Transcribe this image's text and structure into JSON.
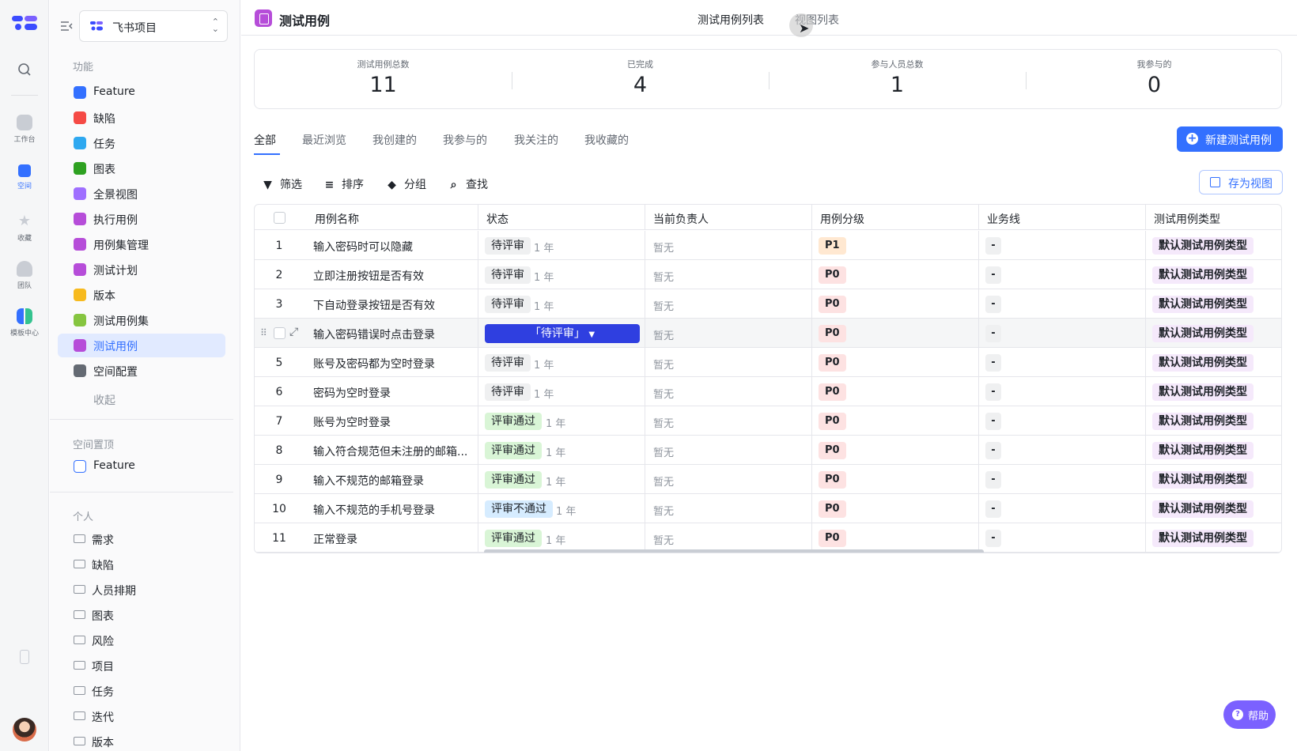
{
  "rail": {
    "items": [
      {
        "label": "",
        "icon": "search-icon"
      },
      {
        "label": "工作台",
        "icon": "home-icon"
      },
      {
        "label": "空间",
        "icon": "space-icon"
      },
      {
        "label": "收藏",
        "icon": "star-icon"
      },
      {
        "label": "团队",
        "icon": "team-icon"
      },
      {
        "label": "模板中心",
        "icon": "template-icon"
      }
    ]
  },
  "sidebar": {
    "project": "飞书项目",
    "features_title": "功能",
    "features": [
      {
        "label": "Feature",
        "color": "#3370ff"
      },
      {
        "label": "缺陷",
        "color": "#f54a45"
      },
      {
        "label": "任务",
        "color": "#2ea8f0"
      },
      {
        "label": "图表",
        "color": "#2ea121"
      },
      {
        "label": "全景视图",
        "color": "#9f6fff"
      },
      {
        "label": "执行用例",
        "color": "#b64dd9"
      },
      {
        "label": "用例集管理",
        "color": "#b64dd9"
      },
      {
        "label": "测试计划",
        "color": "#b64dd9"
      },
      {
        "label": "版本",
        "color": "#f7ba1e"
      },
      {
        "label": "测试用例集",
        "color": "#86c540"
      },
      {
        "label": "测试用例",
        "color": "#b64dd9"
      },
      {
        "label": "空间配置",
        "color": "#646a73"
      }
    ],
    "collapse_label": "收起",
    "pinned_title": "空间置顶",
    "pinned": [
      {
        "label": "Feature"
      }
    ],
    "personal_title": "个人",
    "personal": [
      "需求",
      "缺陷",
      "人员排期",
      "图表",
      "风险",
      "项目",
      "任务",
      "迭代",
      "版本"
    ]
  },
  "header": {
    "title": "测试用例",
    "tabs": [
      "测试用例列表",
      "视图列表"
    ]
  },
  "stats": [
    {
      "label": "测试用例总数",
      "value": "11"
    },
    {
      "label": "已完成",
      "value": "4"
    },
    {
      "label": "参与人员总数",
      "value": "1"
    },
    {
      "label": "我参与的",
      "value": "0"
    }
  ],
  "filter_tabs": [
    "全部",
    "最近浏览",
    "我创建的",
    "我参与的",
    "我关注的",
    "我收藏的"
  ],
  "new_button": "新建测试用例",
  "toolbar": {
    "filter": "筛选",
    "sort": "排序",
    "group": "分组",
    "find": "查找",
    "save_view": "存为视图"
  },
  "table": {
    "columns": [
      "用例名称",
      "状态",
      "当前负责人",
      "用例分级",
      "业务线",
      "测试用例类型"
    ],
    "rows": [
      {
        "idx": "1",
        "name": "输入密码时可以隐藏",
        "status": "待评审",
        "status_kind": "wait",
        "age": "1 年",
        "owner": "暂无",
        "priority": "P1",
        "biz": "-",
        "type": "默认测试用例类型"
      },
      {
        "idx": "2",
        "name": "立即注册按钮是否有效",
        "status": "待评审",
        "status_kind": "wait",
        "age": "1 年",
        "owner": "暂无",
        "priority": "P0",
        "biz": "-",
        "type": "默认测试用例类型"
      },
      {
        "idx": "3",
        "name": "下自动登录按钮是否有效",
        "status": "待评审",
        "status_kind": "wait",
        "age": "1 年",
        "owner": "暂无",
        "priority": "P0",
        "biz": "-",
        "type": "默认测试用例类型"
      },
      {
        "idx": "",
        "name": "输入密码错误时点击登录",
        "status": "「待评审」",
        "status_kind": "select",
        "age": "",
        "owner": "暂无",
        "priority": "P0",
        "biz": "-",
        "type": "默认测试用例类型"
      },
      {
        "idx": "5",
        "name": "账号及密码都为空时登录",
        "status": "待评审",
        "status_kind": "wait",
        "age": "1 年",
        "owner": "暂无",
        "priority": "P0",
        "biz": "-",
        "type": "默认测试用例类型"
      },
      {
        "idx": "6",
        "name": "密码为空时登录",
        "status": "待评审",
        "status_kind": "wait",
        "age": "1 年",
        "owner": "暂无",
        "priority": "P0",
        "biz": "-",
        "type": "默认测试用例类型"
      },
      {
        "idx": "7",
        "name": "账号为空时登录",
        "status": "评审通过",
        "status_kind": "pass",
        "age": "1 年",
        "owner": "暂无",
        "priority": "P0",
        "biz": "-",
        "type": "默认测试用例类型"
      },
      {
        "idx": "8",
        "name": "输入符合规范但未注册的邮箱...",
        "status": "评审通过",
        "status_kind": "pass",
        "age": "1 年",
        "owner": "暂无",
        "priority": "P0",
        "biz": "-",
        "type": "默认测试用例类型"
      },
      {
        "idx": "9",
        "name": "输入不规范的邮箱登录",
        "status": "评审通过",
        "status_kind": "pass",
        "age": "1 年",
        "owner": "暂无",
        "priority": "P0",
        "biz": "-",
        "type": "默认测试用例类型"
      },
      {
        "idx": "10",
        "name": "输入不规范的手机号登录",
        "status": "评审不通过",
        "status_kind": "fail",
        "age": "1 年",
        "owner": "暂无",
        "priority": "P0",
        "biz": "-",
        "type": "默认测试用例类型"
      },
      {
        "idx": "11",
        "name": "正常登录",
        "status": "评审通过",
        "status_kind": "pass",
        "age": "1 年",
        "owner": "暂无",
        "priority": "P0",
        "biz": "-",
        "type": "默认测试用例类型"
      }
    ]
  },
  "help": "帮助",
  "colors": {
    "accent": "#3370ff",
    "select": "#2f3fe0",
    "help": "#7b61ff"
  }
}
